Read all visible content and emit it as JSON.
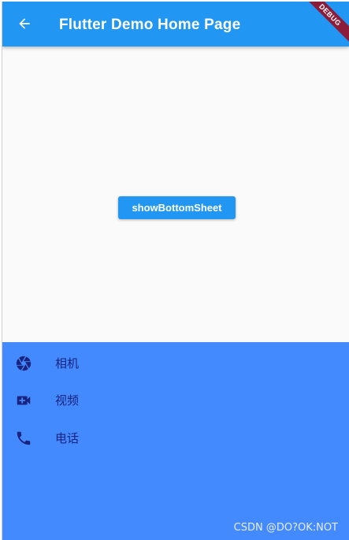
{
  "appbar": {
    "title": "Flutter Demo Home Page",
    "back_icon": "arrow-back-icon",
    "color": "#2196f3"
  },
  "debug_banner": {
    "label": "DEBUG"
  },
  "main": {
    "button_label": "showBottomSheet"
  },
  "bottom_sheet": {
    "color": "#448aff",
    "items": [
      {
        "icon": "camera-icon",
        "label": "相机"
      },
      {
        "icon": "videocam-icon",
        "label": "视频"
      },
      {
        "icon": "phone-icon",
        "label": "电话"
      }
    ]
  },
  "watermark": "CSDN @DO?OK:NOT"
}
